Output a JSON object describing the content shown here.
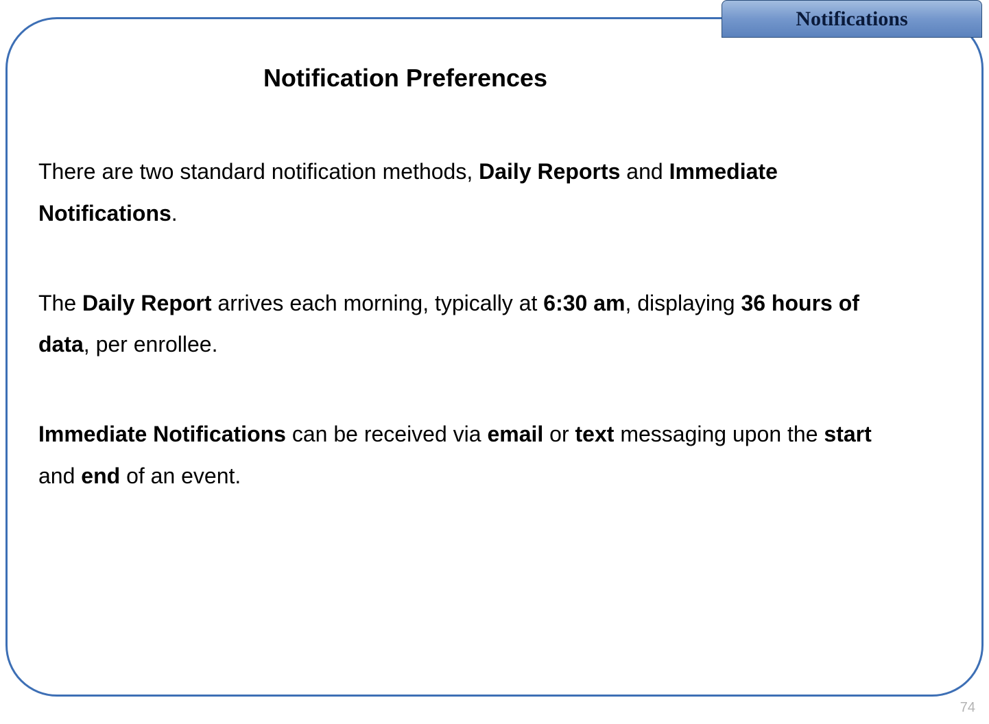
{
  "tab": {
    "label": "Notifications"
  },
  "title": "Notification Preferences",
  "paragraphs": {
    "p1": {
      "s1": "There are two standard notification methods, ",
      "b1": "Daily Reports",
      "s2": " and ",
      "b2": "Immediate Notifications",
      "s3": "."
    },
    "p2": {
      "s1": "The ",
      "b1": "Daily Report",
      "s2": " arrives each morning, typically at ",
      "b2": "6:30 am",
      "s3": ", displaying ",
      "b3": "36 hours of data",
      "s4": ", per enrollee."
    },
    "p3": {
      "b1": "Immediate Notifications",
      "s1": " can be received via ",
      "b2": "email",
      "s2": " or ",
      "b3": "text",
      "s3": " messaging upon the ",
      "b4": "start",
      "s4": " and ",
      "b5": "end",
      "s5": " of an event."
    }
  },
  "pageNumber": "74"
}
